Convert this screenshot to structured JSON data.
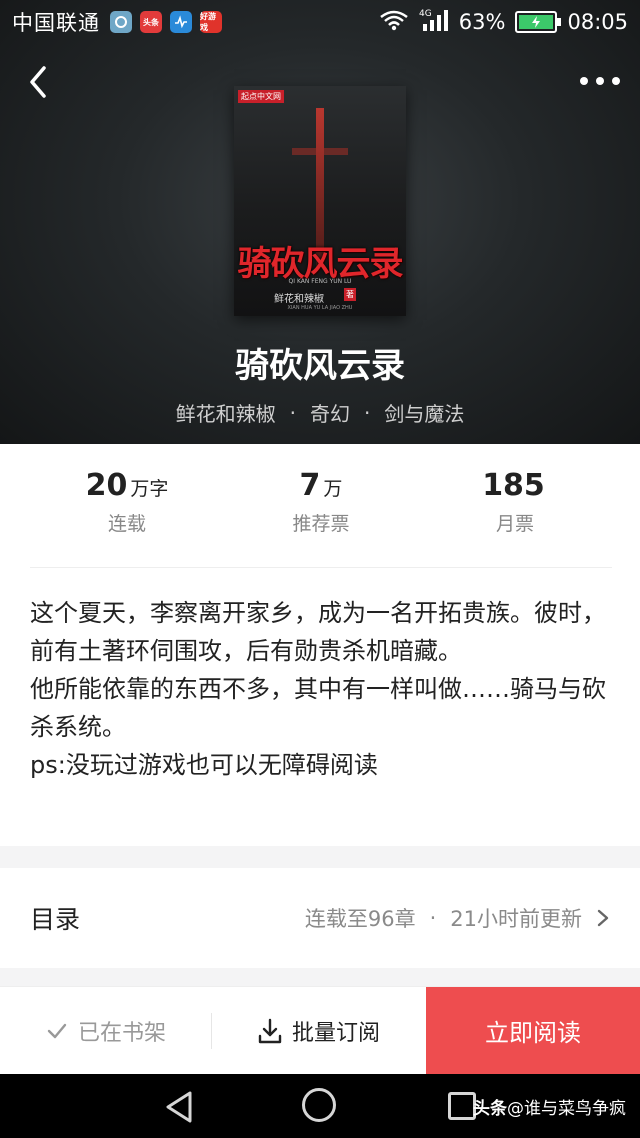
{
  "status_bar": {
    "carrier": "中国联通",
    "notif_b": "头条",
    "notif_d": "好游戏",
    "network": "4G",
    "battery": "63%",
    "time": "08:05"
  },
  "cover": {
    "badge": "起点中文网",
    "title": "骑砍风云录",
    "pinyin": "QI KAN FENG YUN LU",
    "author": "鲜花和辣椒",
    "seal": "著",
    "sub": "XIAN HUA YU LA JIAO ZHU"
  },
  "book": {
    "title": "骑砍风云录",
    "author": "鲜花和辣椒",
    "category": "奇幻",
    "subcategory": "剑与魔法",
    "separator": "·"
  },
  "stats": [
    {
      "value": "20",
      "unit": "万字",
      "label": "连载"
    },
    {
      "value": "7",
      "unit": "万",
      "label": "推荐票"
    },
    {
      "value": "185",
      "unit": "",
      "label": "月票"
    }
  ],
  "description": {
    "line1": "这个夏天，李察离开家乡，成为一名开拓贵族。彼时，前有土著环伺围攻，后有勋贵杀机暗藏。",
    "line2": "他所能依靠的东西不多，其中有一样叫做……骑马与砍杀系统。",
    "line3": "ps:没玩过游戏也可以无障碍阅读"
  },
  "toc": {
    "title": "目录",
    "status": "连载至96章",
    "separator": "·",
    "updated": "21小时前更新"
  },
  "bottom_bar": {
    "shelf_label": "已在书架",
    "batch_label": "批量订阅",
    "read_label": "立即阅读"
  },
  "watermark": {
    "brand": "头条",
    "handle": "@谁与菜鸟争疯"
  },
  "colors": {
    "accent": "#ee4d4f",
    "hero_bg": "#24282a",
    "muted_text": "#888888"
  }
}
